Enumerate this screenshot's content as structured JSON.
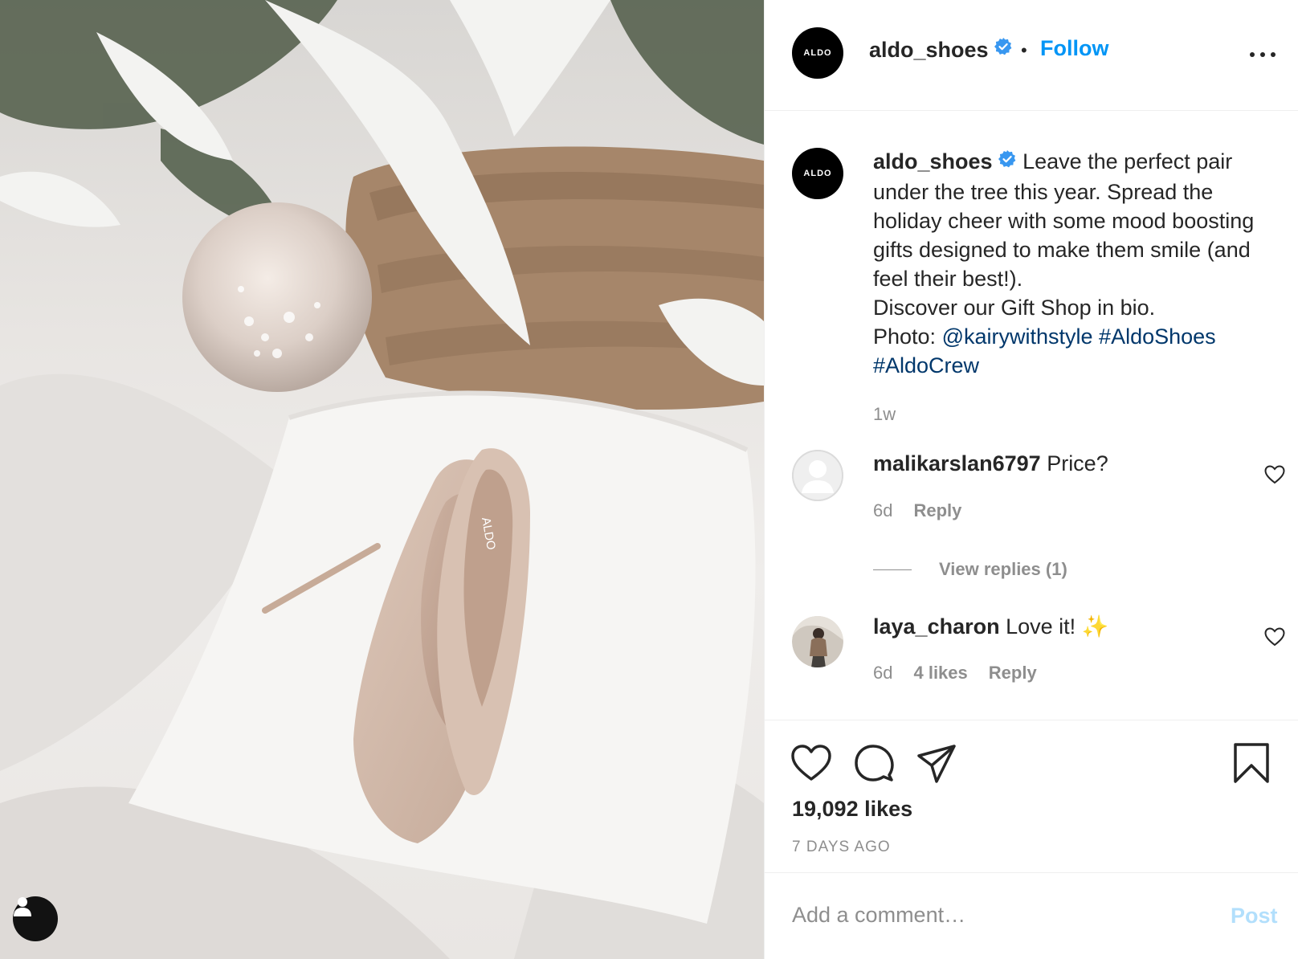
{
  "post": {
    "brand_avatar_text": "ALDO",
    "author": "aldo_shoes",
    "separator": "•",
    "follow_label": "Follow",
    "caption_lines": [
      "Leave the perfect pair under the tree this year. Spread the holiday cheer with some mood boosting gifts designed to make them smile (and feel their best!).",
      "Discover our Gift Shop in bio."
    ],
    "photo_credit_prefix": "Photo:",
    "mention": "@kairywithstyle",
    "hashtags": [
      "#AldoShoes",
      "#AldoCrew"
    ],
    "caption_time": "1w",
    "likes": "19,092 likes",
    "posted": "7 DAYS AGO",
    "photo_brand_text": "ALDO"
  },
  "comments": [
    {
      "user": "malikarslan6797",
      "text": "Price?",
      "time": "6d",
      "reply_label": "Reply",
      "view_replies": "View replies (1)"
    },
    {
      "user": "laya_charon",
      "text": "Love it!",
      "emoji": "✨",
      "time": "6d",
      "likes": "4 likes",
      "reply_label": "Reply"
    }
  ],
  "comment_box": {
    "placeholder": "Add a comment…",
    "post_label": "Post"
  },
  "colors": {
    "accent": "#0095f6",
    "link": "#00376b",
    "muted": "#8e8e8e",
    "text": "#262626",
    "post_disabled": "#b2dffc"
  },
  "icons": {
    "verified": "verified-badge-icon",
    "more": "more-options-icon",
    "like": "heart-icon",
    "comment": "comment-bubble-icon",
    "share": "paper-plane-icon",
    "save": "bookmark-icon",
    "user_tag": "user-tag-icon"
  }
}
